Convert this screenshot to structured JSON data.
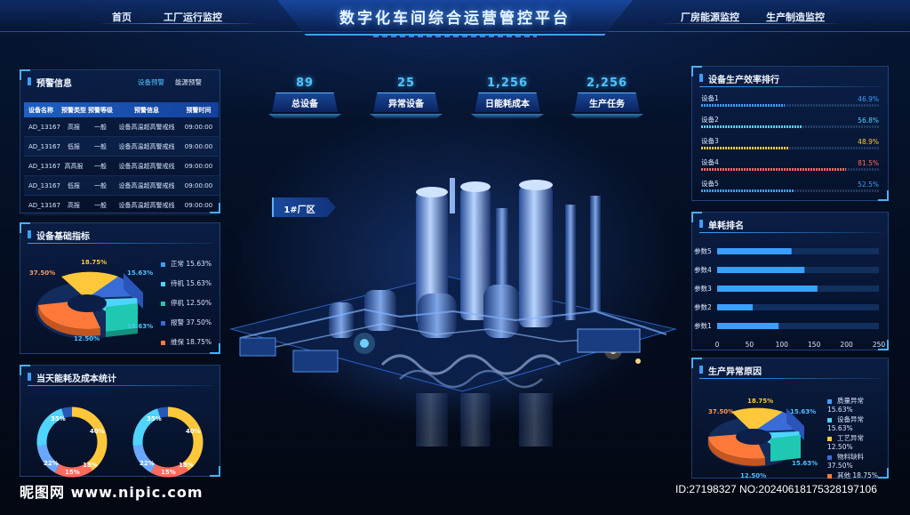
{
  "header": {
    "title": "数字化车间综合运营管控平台",
    "nav_left": [
      "首页",
      "工厂运行监控"
    ],
    "nav_right": [
      "厂房能源监控",
      "生产制造监控"
    ]
  },
  "warning": {
    "title": "预警信息",
    "tabs": [
      "设备预警",
      "能源预警"
    ],
    "columns": [
      "设备名称",
      "预警类型",
      "预警等级",
      "预警信息",
      "预警时间"
    ],
    "rows": [
      [
        "AD_13167",
        "高报",
        "一般",
        "设备高温超高警戒线",
        "09:00:00"
      ],
      [
        "AD_13167",
        "低报",
        "一般",
        "设备高温超高警戒线",
        "09:00:00"
      ],
      [
        "AD_13167",
        "高高报",
        "一般",
        "设备高温超高警戒线",
        "09:00:00"
      ],
      [
        "AD_13167",
        "低报",
        "一般",
        "设备高温超高警戒线",
        "09:00:00"
      ],
      [
        "AD_13167",
        "高报",
        "一般",
        "设备高温超高警戒线",
        "09:00:00"
      ]
    ]
  },
  "base_indicators": {
    "title": "设备基础指标",
    "slice_labels": [
      "37.50%",
      "18.75%",
      "15.63%",
      "15.63%",
      "12.50%"
    ],
    "legend": [
      {
        "name": "正常",
        "value": "15.63%",
        "color": "#3aa0ff"
      },
      {
        "name": "待机",
        "value": "15.63%",
        "color": "#4fd4ff"
      },
      {
        "name": "停机",
        "value": "12.50%",
        "color": "#1fc8b0"
      },
      {
        "name": "报警",
        "value": "37.50%",
        "color": "#3a6cd8"
      },
      {
        "name": "维保",
        "value": "18.75%",
        "color": "#ff7a3a"
      }
    ]
  },
  "energy_cost": {
    "title": "当天能耗及成本统计",
    "donut_labels": [
      "35%",
      "40%",
      "22%",
      "15%",
      "18%"
    ]
  },
  "kpis": [
    {
      "value": "89",
      "label": "总设备"
    },
    {
      "value": "25",
      "label": "异常设备"
    },
    {
      "value": "1,256",
      "label": "日能耗成本"
    },
    {
      "value": "2,256",
      "label": "生产任务"
    }
  ],
  "zone": {
    "label": "1#厂区"
  },
  "efficiency": {
    "title": "设备生产效率排行",
    "items": [
      {
        "name": "设备1",
        "value": 46.9,
        "text": "46.9%",
        "color": "#3aa0ff"
      },
      {
        "name": "设备2",
        "value": 56.8,
        "text": "56.8%",
        "color": "#4fd4ff"
      },
      {
        "name": "设备3",
        "value": 48.9,
        "text": "48.9%",
        "color": "#ffc83a"
      },
      {
        "name": "设备4",
        "value": 81.5,
        "text": "81.5%",
        "color": "#ff6a5a"
      },
      {
        "name": "设备5",
        "value": 52.5,
        "text": "52.5%",
        "color": "#3aa0ff"
      }
    ]
  },
  "chart_data": {
    "type": "bar",
    "title": "单耗排名",
    "categories": [
      "参数5",
      "参数4",
      "参数3",
      "参数2",
      "参数1"
    ],
    "values": [
      115,
      135,
      155,
      55,
      95
    ],
    "xlim": [
      0,
      250
    ],
    "xticks": [
      "0",
      "50",
      "100",
      "150",
      "200",
      "250"
    ]
  },
  "abnormal": {
    "title": "生产异常原因",
    "slice_labels": [
      "37.50%",
      "18.75%",
      "15.63%",
      "15.63%",
      "12.50%"
    ],
    "legend": [
      {
        "name": "质量异常",
        "value": "15.63%",
        "color": "#3aa0ff"
      },
      {
        "name": "设备异常",
        "value": "15.63%",
        "color": "#4fd4ff"
      },
      {
        "name": "工艺异常",
        "value": "12.50%",
        "color": "#ffc83a"
      },
      {
        "name": "物料缺料",
        "value": "37.50%",
        "color": "#3a6cd8"
      },
      {
        "name": "其他",
        "value": "18.75%",
        "color": "#ff7a3a"
      }
    ]
  },
  "footer": {
    "logo": "昵图网 www.nipic.com",
    "id": "ID:27198327 NO:20240618175328197106"
  }
}
